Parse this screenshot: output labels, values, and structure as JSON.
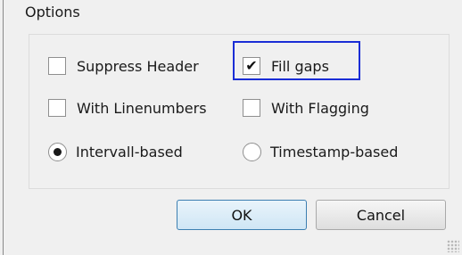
{
  "options": {
    "title": "Options",
    "suppress_header": {
      "label": "Suppress Header",
      "checked": false
    },
    "fill_gaps": {
      "label": "Fill gaps",
      "checked": true,
      "check_glyph": "✔"
    },
    "with_linenumbers": {
      "label": "With Linenumbers",
      "checked": false
    },
    "with_flagging": {
      "label": "With Flagging",
      "checked": false
    },
    "intervall_based": {
      "label": "Intervall-based",
      "selected": true
    },
    "timestamp_based": {
      "label": "Timestamp-based",
      "selected": false
    }
  },
  "buttons": {
    "ok_label": "OK",
    "cancel_label": "Cancel"
  },
  "colors": {
    "focus_ring": "#1a2dd6",
    "ok_border": "#3c7fb1"
  }
}
